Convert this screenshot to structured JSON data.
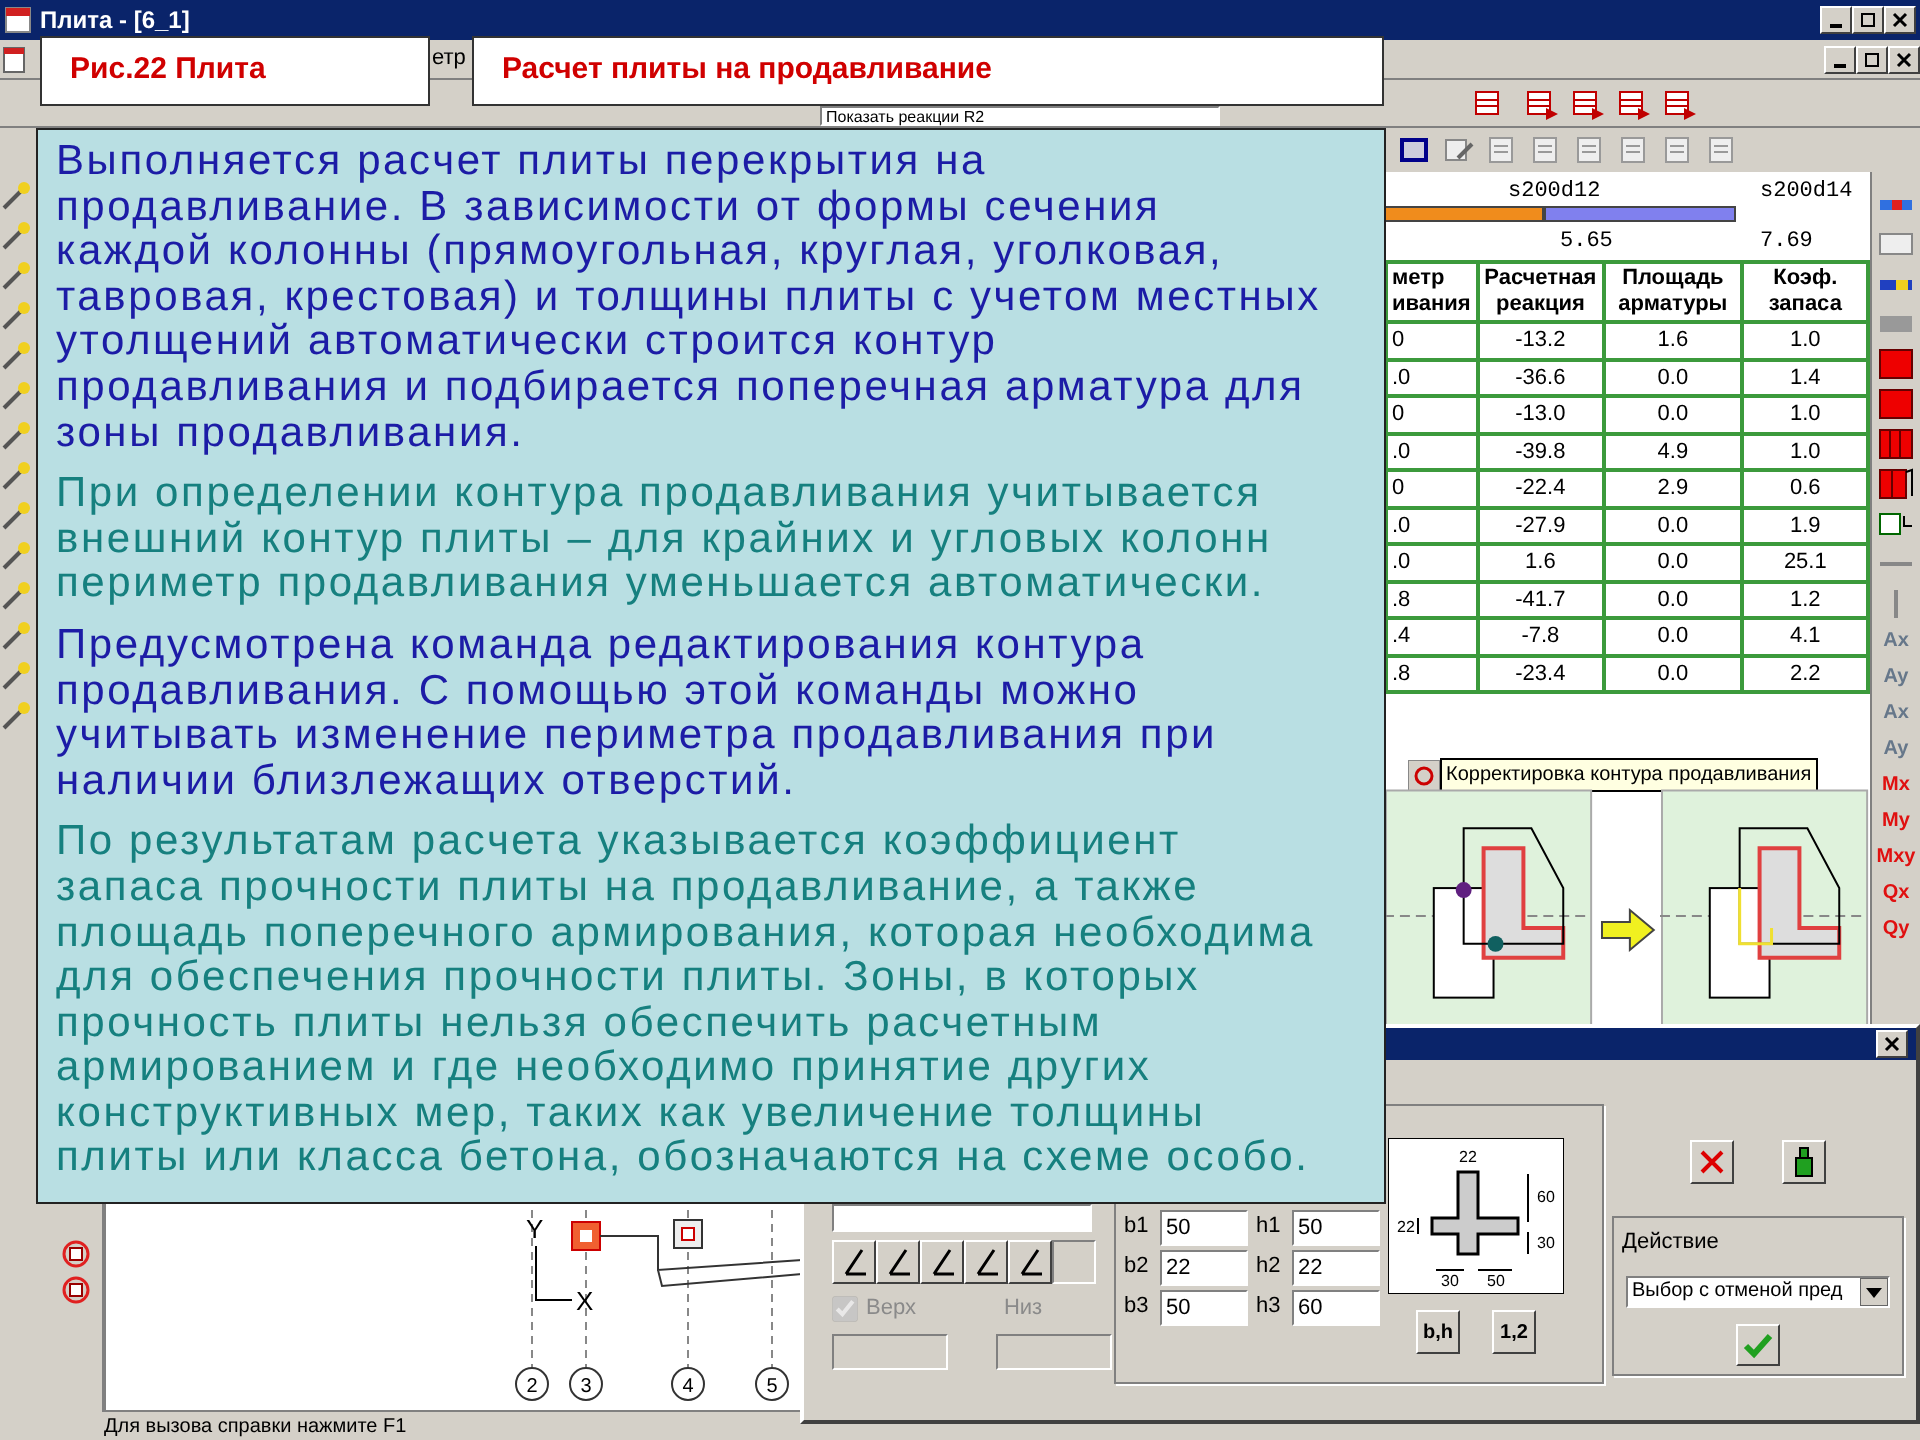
{
  "window": {
    "title": "Плита - [6_1]"
  },
  "header_labels": [
    {
      "text": "Рис.22 Плита"
    },
    {
      "text": "Расчет плиты на продавливание"
    }
  ],
  "menu_fragment": "етр",
  "reactions_dropdown": {
    "value": "Показать реакции R2"
  },
  "description": {
    "paragraphs": [
      {
        "lines": [
          "Выполняется расчет плиты перекрытия на",
          "продавливание. В зависимости от формы сечения",
          "каждой колонны (прямоугольная, круглая, уголковая,",
          "тавровая, крестовая) и толщины плиты с учетом местных",
          "утолщений автоматически строится контур",
          "продавливания и подбирается поперечная арматура для",
          "зоны продавливания."
        ],
        "color": "#1c1ca6"
      },
      {
        "lines": [
          "При определении контура продавливания учитывается",
          "внешний контур плиты – для крайних и угловых колонн",
          "периметр продавливания уменьшается автоматически."
        ],
        "color": "#16807f"
      },
      {
        "lines": [
          "Предусмотрена команда редактирования контура",
          "продавливания. С помощью этой команды можно",
          "учитывать изменение периметра продавливания при",
          "наличии близлежащих отверстий."
        ],
        "color": "#1c1ca6"
      },
      {
        "lines": [
          "По результатам расчета указывается коэффициент",
          "запаса прочности плиты на продавливание, а также",
          "площадь поперечного армирования, которая необходима",
          "для обеспечения прочности плиты. Зоны, в которых",
          "прочность плиты нельзя обеспечить расчетным",
          "армированием и где необходимо принятие других",
          "конструктивных мер, таких как увеличение толщины",
          "плиты или класса бетона, обозначаются на схеме особо."
        ],
        "color": "#16807f"
      }
    ]
  },
  "rebar_legend": {
    "labels": [
      "s200d12",
      "s200d14"
    ],
    "values": [
      "5.65",
      "7.69"
    ]
  },
  "table": {
    "columns": [
      {
        "label": "метр\nивания"
      },
      {
        "label": "Расчетная\nреакция"
      },
      {
        "label": "Площадь\nарматуры"
      },
      {
        "label": "Коэф.\nзапаса"
      }
    ],
    "rows": [
      [
        "0",
        "-13.2",
        "1.6",
        "1.0"
      ],
      [
        ".0",
        "-36.6",
        "0.0",
        "1.4"
      ],
      [
        "0",
        "-13.0",
        "0.0",
        "1.0"
      ],
      [
        ".0",
        "-39.8",
        "4.9",
        "1.0"
      ],
      [
        "0",
        "-22.4",
        "2.9",
        "0.6"
      ],
      [
        ".0",
        "-27.9",
        "0.0",
        "1.9"
      ],
      [
        ".0",
        "1.6",
        "0.0",
        "25.1"
      ],
      [
        ".8",
        "-41.7",
        "0.0",
        "1.2"
      ],
      [
        ".4",
        "-7.8",
        "0.0",
        "4.1"
      ],
      [
        ".8",
        "-23.4",
        "0.0",
        "2.2"
      ]
    ]
  },
  "tooltip": {
    "text": "Корректировка контура продавливания"
  },
  "right_toolbar": {
    "labels": [
      {
        "text": "Ax",
        "color": "#66778a"
      },
      {
        "text": "Ay",
        "color": "#66778a"
      },
      {
        "text": "Ax",
        "color": "#66778a"
      },
      {
        "text": "Ay",
        "color": "#66778a"
      },
      {
        "text": "Mx",
        "color": "#e01010"
      },
      {
        "text": "My",
        "color": "#e01010"
      },
      {
        "text": "Mxy",
        "color": "#e01010"
      },
      {
        "text": "Qx",
        "color": "#e01010"
      },
      {
        "text": "Qy",
        "color": "#e01010"
      }
    ]
  },
  "plan": {
    "axis_labels": [
      "Y",
      "X"
    ],
    "grid_axes": [
      "2",
      "3",
      "4",
      "5"
    ]
  },
  "status_bar": "Для вызова справки нажмите F1",
  "dialog": {
    "checkboxes": [
      {
        "label": "Верх",
        "checked": true,
        "disabled": true
      }
    ],
    "side_label": {
      "text": "Низ",
      "disabled": true
    },
    "fields": [
      {
        "label": "b1",
        "value": "50"
      },
      {
        "label": "h1",
        "value": "50"
      },
      {
        "label": "b2",
        "value": "22"
      },
      {
        "label": "h2",
        "value": "22"
      },
      {
        "label": "b3",
        "value": "50"
      },
      {
        "label": "h3",
        "value": "60"
      }
    ],
    "section_dims": [
      "22",
      "60",
      "22",
      "30",
      "30",
      "50"
    ],
    "mode_buttons": [
      "b,h",
      "1,2"
    ],
    "action_group": {
      "title": "Действие",
      "value": "Выбор с отменой пред"
    }
  }
}
